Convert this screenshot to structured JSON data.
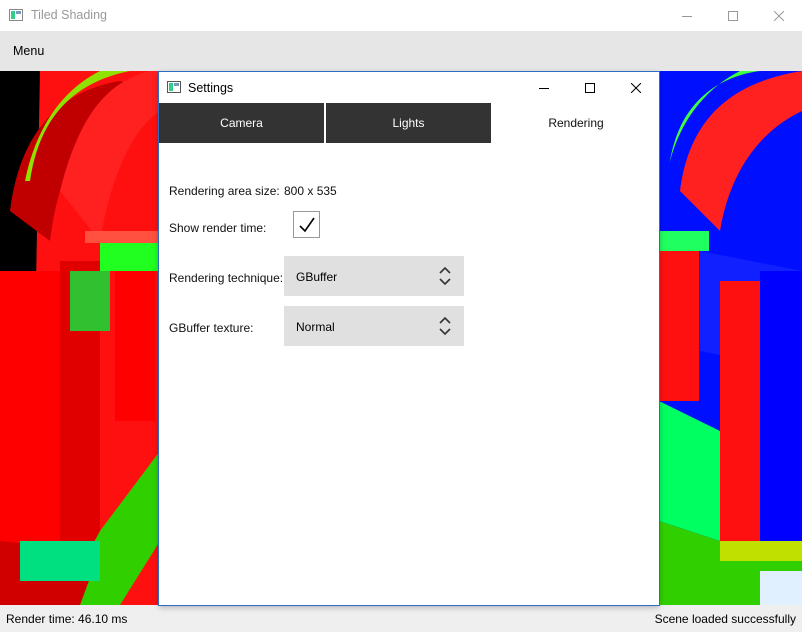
{
  "main_window": {
    "title": "Tiled Shading",
    "menu_label": "Menu"
  },
  "status": {
    "render_time": "Render time: 46.10 ms",
    "scene_status": "Scene loaded successfully"
  },
  "settings": {
    "title": "Settings",
    "tabs": [
      {
        "label": "Camera",
        "active": false
      },
      {
        "label": "Lights",
        "active": false
      },
      {
        "label": "Rendering",
        "active": true
      }
    ],
    "rendering_area_label": "Rendering area size:",
    "rendering_area_value": "800 x 535",
    "show_render_time_label": "Show render time:",
    "show_render_time_checked": true,
    "technique_label": "Rendering technique:",
    "technique_value": "GBuffer",
    "gbuffer_texture_label": "GBuffer texture:",
    "gbuffer_texture_value": "Normal"
  },
  "icons": {
    "app": "app-window-icon",
    "minimize": "minimize-icon",
    "maximize": "maximize-icon",
    "close": "close-icon",
    "check": "checkmark-icon",
    "select_arrows": "updown-chevron-icon"
  }
}
